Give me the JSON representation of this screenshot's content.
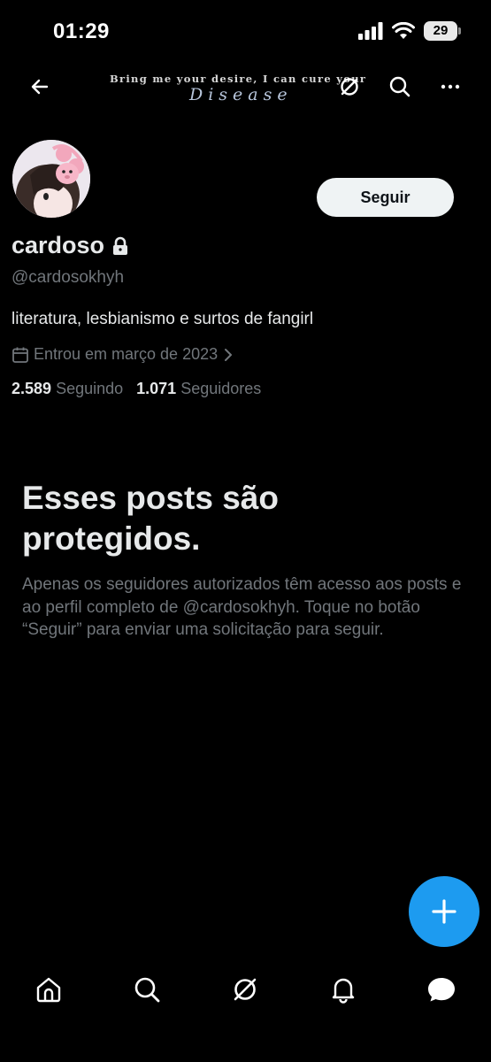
{
  "status_bar": {
    "time": "01:29",
    "battery": "29"
  },
  "banner": {
    "line1": "Bring me your desire, I can cure your",
    "line2": "Disease"
  },
  "profile": {
    "display_name": "cardoso",
    "handle": "@cardosokhyh",
    "bio": "literatura, lesbianismo e surtos de fangirl",
    "joined": "Entrou em março de 2023",
    "following_count": "2.589",
    "following_label": "Seguindo",
    "followers_count": "1.071",
    "followers_label": "Seguidores",
    "follow_button": "Seguir"
  },
  "protected": {
    "title": "Esses posts são protegidos.",
    "description": "Apenas os seguidores autorizados têm acesso aos posts e ao perfil completo de @cardosokhyh. Toque no botão “Seguir” para enviar uma solicitação para seguir."
  },
  "colors": {
    "accent": "#1d9bf0",
    "background": "#000000",
    "text_primary": "#e7e9ea",
    "text_secondary": "#71767b"
  },
  "icons": {
    "nav": [
      "back-arrow-icon",
      "grok-icon",
      "search-icon",
      "more-icon"
    ],
    "tabs": [
      "home-icon",
      "search-icon",
      "grok-icon",
      "notifications-icon",
      "messages-icon"
    ]
  }
}
